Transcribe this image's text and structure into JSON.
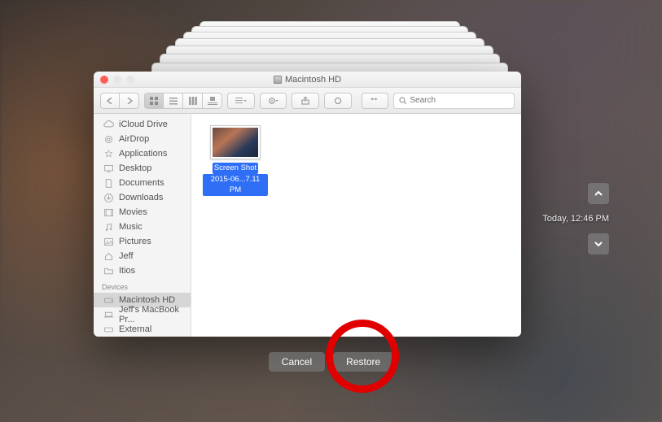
{
  "window": {
    "title": "Macintosh HD"
  },
  "toolbar": {
    "search_placeholder": "Search"
  },
  "sidebar": {
    "favorites": [
      {
        "label": "iCloud Drive",
        "icon": "cloud-icon"
      },
      {
        "label": "AirDrop",
        "icon": "airdrop-icon"
      },
      {
        "label": "Applications",
        "icon": "applications-icon"
      },
      {
        "label": "Desktop",
        "icon": "desktop-icon"
      },
      {
        "label": "Documents",
        "icon": "documents-icon"
      },
      {
        "label": "Downloads",
        "icon": "downloads-icon"
      },
      {
        "label": "Movies",
        "icon": "movies-icon"
      },
      {
        "label": "Music",
        "icon": "music-icon"
      },
      {
        "label": "Pictures",
        "icon": "pictures-icon"
      },
      {
        "label": "Jeff",
        "icon": "home-icon"
      },
      {
        "label": "Itios",
        "icon": "folder-icon"
      }
    ],
    "devices_header": "Devices",
    "devices": [
      {
        "label": "Macintosh HD",
        "icon": "hd-icon",
        "selected": true
      },
      {
        "label": "Jeff's MacBook Pr...",
        "icon": "laptop-icon",
        "selected": false
      },
      {
        "label": "External",
        "icon": "disk-icon",
        "selected": false
      }
    ]
  },
  "file": {
    "name_line1": "Screen Shot",
    "name_line2": "2015-06...7.11 PM"
  },
  "timemachine": {
    "label": "Today, 12:46 PM"
  },
  "buttons": {
    "cancel": "Cancel",
    "restore": "Restore"
  }
}
